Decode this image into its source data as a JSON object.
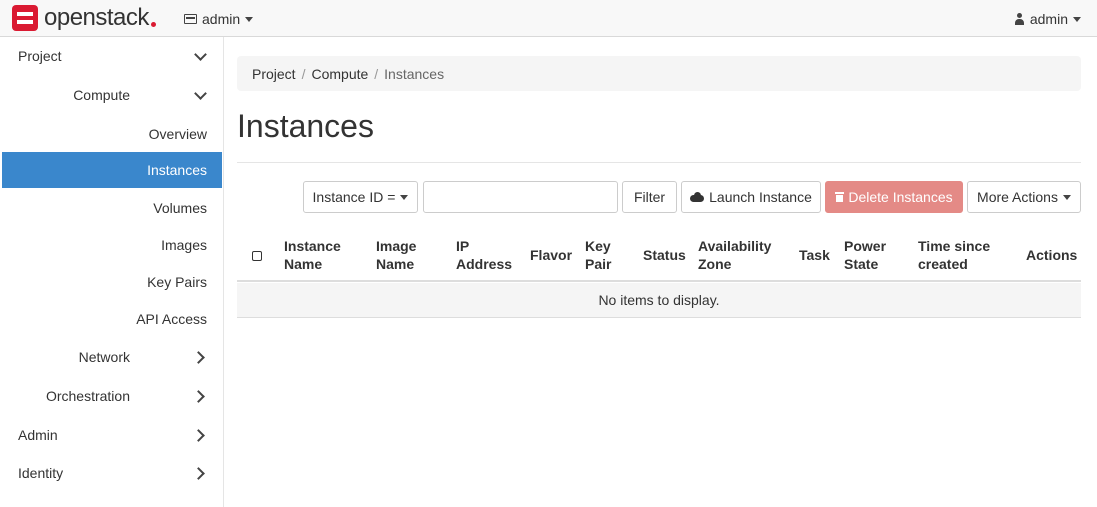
{
  "brand": {
    "name": "openstack",
    "color": "#da1a32"
  },
  "topbar": {
    "project_selector": "admin",
    "user_menu": "admin"
  },
  "sidebar": {
    "project": "Project",
    "compute": "Compute",
    "overview": "Overview",
    "instances": "Instances",
    "volumes": "Volumes",
    "images": "Images",
    "key_pairs": "Key Pairs",
    "api_access": "API Access",
    "network": "Network",
    "orchestration": "Orchestration",
    "admin": "Admin",
    "identity": "Identity",
    "active_color": "#3a87cc"
  },
  "breadcrumb": {
    "crumb1": "Project",
    "crumb2": "Compute",
    "current": "Instances",
    "separator": "/"
  },
  "page": {
    "title": "Instances"
  },
  "toolbar": {
    "filter_field": "Instance ID =",
    "filter_value": "",
    "filter_button": "Filter",
    "launch_button": "Launch Instance",
    "delete_button": "Delete Instances",
    "more_button": "More Actions"
  },
  "table": {
    "headers": {
      "instance_name": "Instance Name",
      "image_name": "Image Name",
      "ip_address": "IP Address",
      "flavor": "Flavor",
      "key_pair": "Key Pair",
      "status": "Status",
      "availability_zone": "Availability Zone",
      "task": "Task",
      "power_state": "Power State",
      "time_since_created": "Time since created",
      "actions": "Actions"
    },
    "empty_message": "No items to display."
  }
}
